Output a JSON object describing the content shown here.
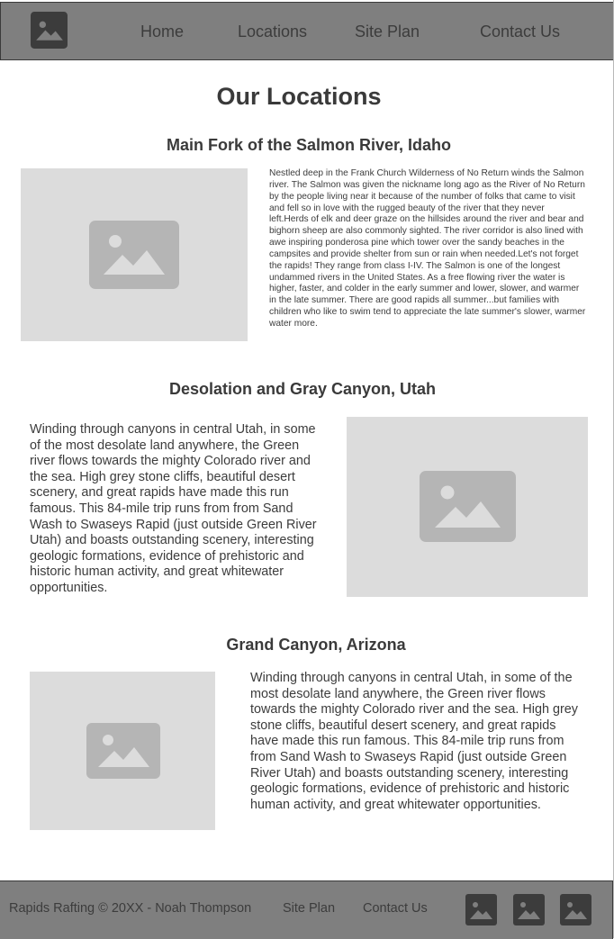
{
  "header": {
    "logo_icon": "image-placeholder-icon",
    "nav": [
      {
        "label": "Home"
      },
      {
        "label": "Locations"
      },
      {
        "label": "Site Plan"
      },
      {
        "label": "Contact Us"
      }
    ]
  },
  "main": {
    "title": "Our Locations",
    "sections": [
      {
        "title": "Main Fork of the Salmon River, Idaho",
        "image_icon": "image-placeholder-icon",
        "text": "Nestled deep in the Frank Church Wilderness of No Return winds the Salmon river. The Salmon was given the nickname long ago as the River of No Return by the people living near it because of the number of folks that came to visit and fell so in love with the rugged beauty of the river that they never left.Herds of elk and deer graze on the hillsides around the river and bear and bighorn sheep are also commonly sighted. The river corridor is also lined with awe inspiring ponderosa pine which tower over the sandy beaches in the campsites and provide shelter from sun or rain when needed.Let's not forget the rapids! They range from class I-IV. The Salmon is one of the longest undammed rivers in the United States. As a free flowing river the water is higher, faster, and colder in the early summer and lower, slower, and warmer in the late summer. There are good rapids all summer...but families with children who like to swim tend to appreciate the late summer's slower, warmer water more."
      },
      {
        "title": "Desolation and Gray Canyon, Utah",
        "image_icon": "image-placeholder-icon",
        "text": "Winding through canyons in central Utah, in some of the most desolate land anywhere, the Green river flows towards the mighty Colorado river and the sea. High grey stone cliffs, beautiful desert scenery, and great rapids have made this run famous. This 84-mile trip runs from from Sand Wash to Swaseys Rapid (just outside Green River Utah) and boasts outstanding scenery, interesting geologic formations, evidence of prehistoric and historic human activity, and great whitewater opportunities."
      },
      {
        "title": "Grand Canyon, Arizona",
        "image_icon": "image-placeholder-icon",
        "text": "Winding through canyons in central Utah, in some of the most desolate land anywhere, the Green river flows towards the mighty Colorado river and the sea. High grey stone cliffs, beautiful desert scenery, and great rapids have made this run famous. This 84-mile trip runs from from Sand Wash to Swaseys Rapid (just outside Green River Utah) and boasts outstanding scenery, interesting geologic formations, evidence of prehistoric and historic human activity, and great whitewater opportunities."
      }
    ]
  },
  "footer": {
    "copyright": "Rapids Rafting © 20XX - Noah Thompson",
    "links": [
      {
        "label": "Site Plan"
      },
      {
        "label": "Contact Us"
      }
    ],
    "social_icons": [
      "image-placeholder-icon",
      "image-placeholder-icon",
      "image-placeholder-icon"
    ]
  },
  "colors": {
    "header_bg": "#7f7f7f",
    "placeholder_bg": "#dcdcdc",
    "placeholder_icon": "#b5b5b5",
    "dark_icon": "#3c3c3c",
    "text": "#3c3c3c"
  }
}
